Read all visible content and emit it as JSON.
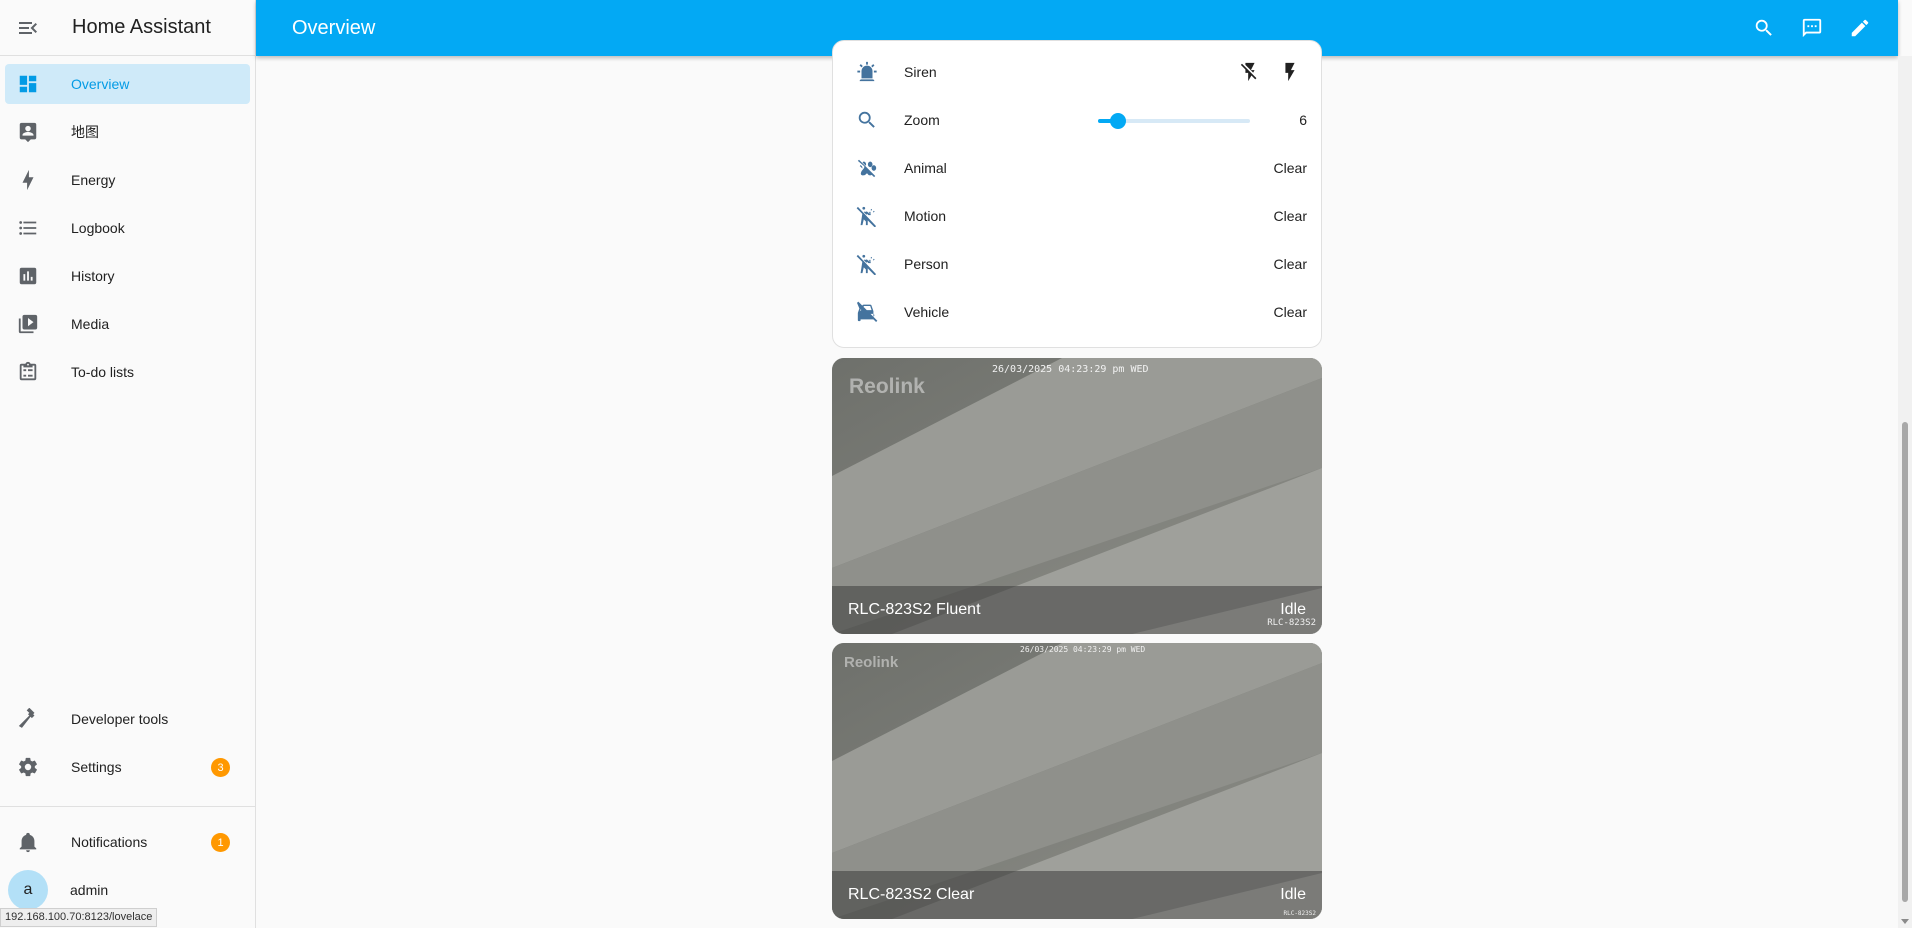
{
  "app": {
    "title": "Home Assistant"
  },
  "sidebar": {
    "items": [
      {
        "label": "Overview",
        "icon": "dashboard-icon",
        "active": true
      },
      {
        "label": "地图",
        "icon": "map-account-icon"
      },
      {
        "label": "Energy",
        "icon": "lightning-bolt-icon"
      },
      {
        "label": "Logbook",
        "icon": "logbook-list-icon"
      },
      {
        "label": "History",
        "icon": "chart-box-icon"
      },
      {
        "label": "Media",
        "icon": "play-box-multiple-icon"
      },
      {
        "label": "To-do lists",
        "icon": "clipboard-list-icon"
      }
    ],
    "bottom_items": [
      {
        "label": "Developer tools",
        "icon": "hammer-icon"
      },
      {
        "label": "Settings",
        "icon": "gear-icon",
        "badge": "3"
      }
    ],
    "notifications": {
      "label": "Notifications",
      "badge": "1"
    },
    "user": {
      "label": "admin",
      "avatar_letter": "a"
    }
  },
  "status_bar": {
    "url": "192.168.100.70:8123/lovelace"
  },
  "topbar": {
    "title": "Overview"
  },
  "entities": [
    {
      "name": "Siren",
      "icon": "alarm-light-icon",
      "state": ""
    },
    {
      "name": "Zoom",
      "icon": "magnify-icon",
      "state": "6",
      "slider_fraction": 0.13
    },
    {
      "name": "Animal",
      "icon": "paw-off-icon",
      "state": "Clear"
    },
    {
      "name": "Motion",
      "icon": "motion-sensor-off-icon",
      "state": "Clear"
    },
    {
      "name": "Person",
      "icon": "motion-sensor-off-icon",
      "state": "Clear"
    },
    {
      "name": "Vehicle",
      "icon": "car-off-icon",
      "state": "Clear"
    }
  ],
  "cameras": [
    {
      "name": "RLC-823S2 Fluent",
      "state": "Idle",
      "timestamp": "26/03/2025 04:23:29 pm WED",
      "logo": "Reolink",
      "watermark": "RLC-823S2"
    },
    {
      "name": "RLC-823S2 Clear",
      "state": "Idle",
      "timestamp": "26/03/2025 04:23:29 pm WED",
      "logo": "Reolink",
      "watermark": "RLC-823S2"
    }
  ],
  "colors": {
    "primary": "#03a9f4",
    "badge": "#ff9800",
    "icon": "#44739e"
  }
}
